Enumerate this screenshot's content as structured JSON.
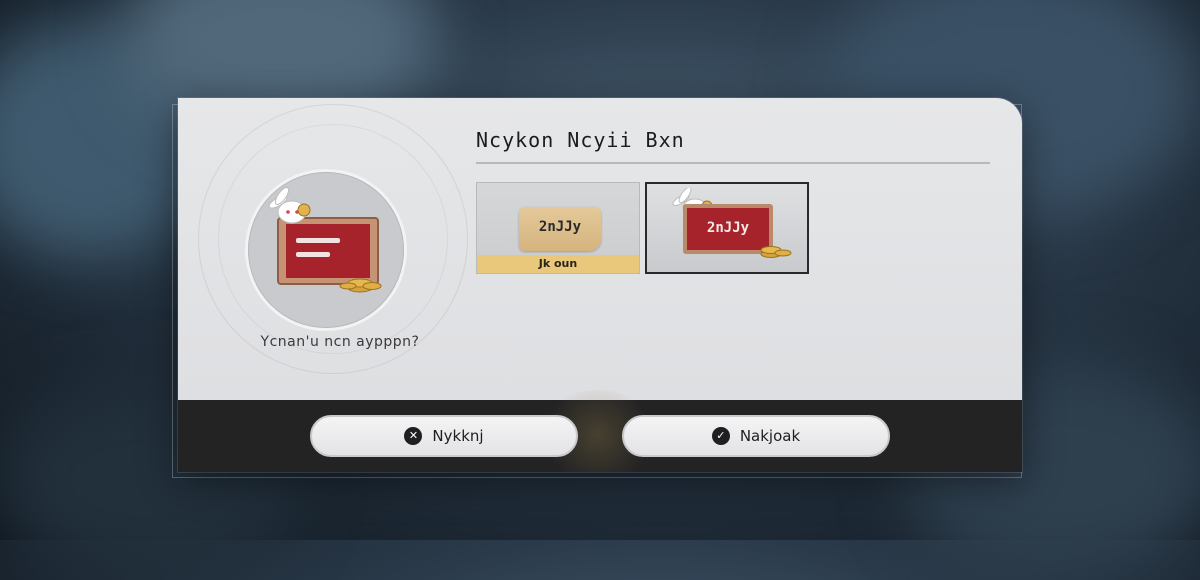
{
  "dialog": {
    "title": "Ncykon Ncyii Bxn",
    "prompt": "Ycnan'u ncn aypppn?"
  },
  "options": [
    {
      "name": "option-1",
      "card_label": "2nJJy",
      "strip_label": "Jk oun",
      "selected": false
    },
    {
      "name": "option-2",
      "card_label": "2nJJy",
      "selected": true
    }
  ],
  "buttons": {
    "cancel_label": "Nykknj",
    "confirm_label": "Nakjoak",
    "cancel_icon": "close-icon",
    "confirm_icon": "check-icon"
  },
  "colors": {
    "panel": "#e1e2e4",
    "bar": "#232324",
    "red_card": "#a7232c",
    "gold_card": "#dcc08c",
    "gold_strip": "#e9c77b"
  }
}
